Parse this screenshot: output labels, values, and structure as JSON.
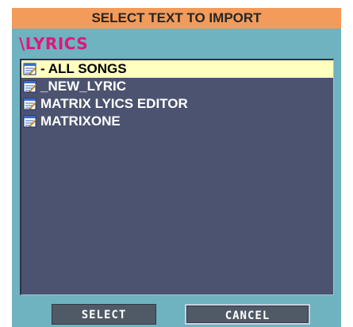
{
  "dialog": {
    "title": "SELECT TEXT TO IMPORT",
    "path": "\\LYRICS",
    "icon": "document-icon",
    "colors": {
      "title_bar": "#f39b5a",
      "background": "#6fb2c0",
      "list_bg": "#4b5370",
      "path_text": "#e0167a",
      "selected_row": "#ffffc0"
    }
  },
  "list": {
    "selected_index": 0,
    "items": [
      {
        "label": "- ALL SONGS"
      },
      {
        "label": "_NEW_LYRIC"
      },
      {
        "label": "MATRIX LYICS EDITOR"
      },
      {
        "label": "MATRIXONE"
      }
    ]
  },
  "buttons": {
    "select_label": "SELECT",
    "cancel_label": "CANCEL"
  }
}
